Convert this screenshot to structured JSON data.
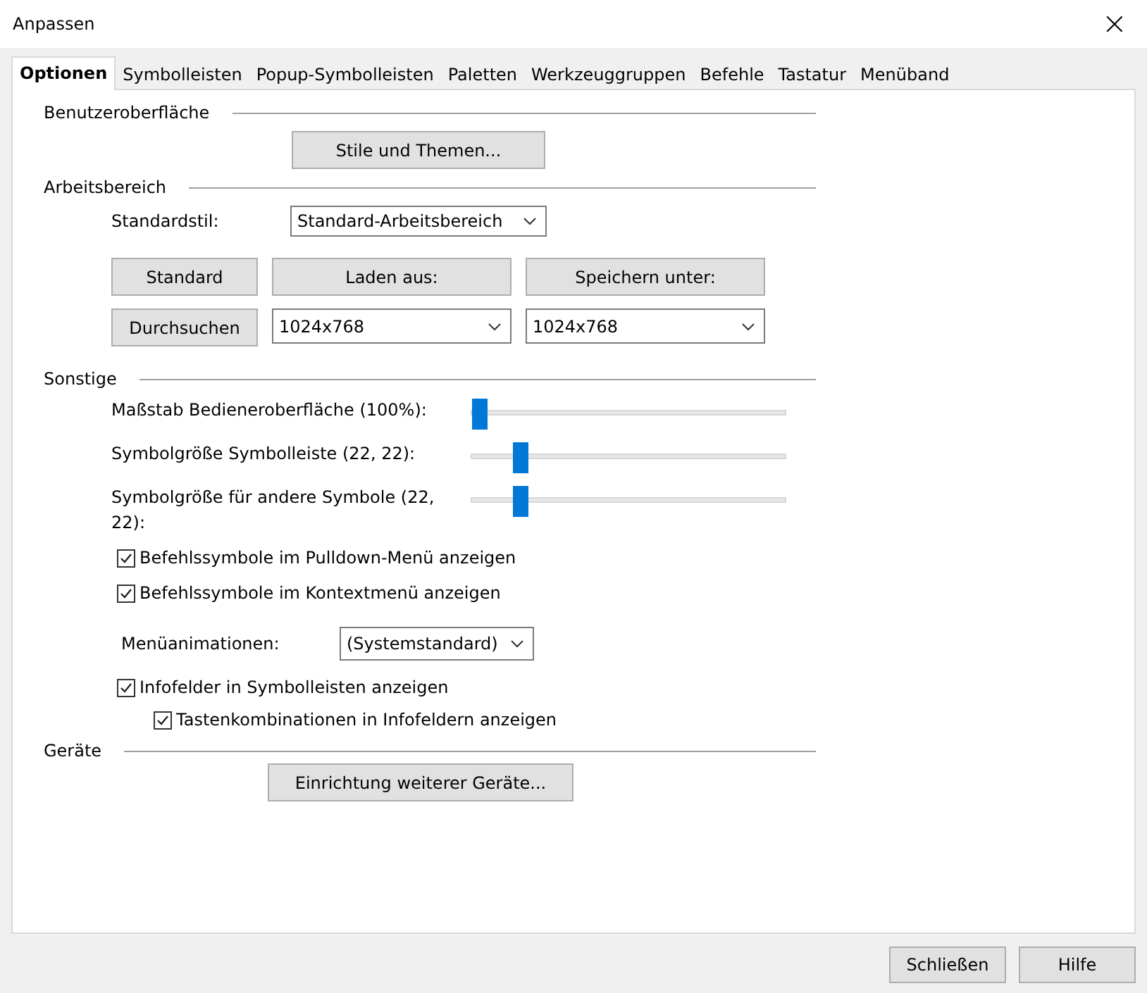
{
  "window": {
    "title": "Anpassen",
    "close": "×"
  },
  "tabs": [
    {
      "label": "Optionen",
      "selected": true
    },
    {
      "label": "Symbolleisten",
      "selected": false
    },
    {
      "label": "Popup-Symbolleisten",
      "selected": false
    },
    {
      "label": "Paletten",
      "selected": false
    },
    {
      "label": "Werkzeuggruppen",
      "selected": false
    },
    {
      "label": "Befehle",
      "selected": false
    },
    {
      "label": "Tastatur",
      "selected": false
    },
    {
      "label": "Menüband",
      "selected": false
    }
  ],
  "sections": [
    {
      "title": "Benutzeroberfläche",
      "items": [
        {
          "kind": "button",
          "label": "Stile und Themen..."
        }
      ]
    },
    {
      "title": "Arbeitsbereich",
      "items": [
        {
          "kind": "select",
          "label": "Standardstil:",
          "value": "Standard-Arbeitsbereich"
        },
        {
          "kind": "grid",
          "cells": [
            {
              "kind": "button",
              "label": "Standard"
            },
            {
              "kind": "button",
              "label": "Laden aus:"
            },
            {
              "kind": "button",
              "label": "Speichern unter:"
            },
            {
              "kind": "button",
              "label": "Durchsuchen"
            },
            {
              "kind": "select",
              "value": "1024x768"
            },
            {
              "kind": "select",
              "value": "1024x768"
            }
          ]
        }
      ]
    },
    {
      "title": "Sonstige",
      "items": [
        {
          "kind": "slider",
          "label": "Maßstab Bedieneroberfläche (100%):",
          "level": 0.0
        },
        {
          "kind": "slider",
          "label": "Symbolgröße Symbolleiste (22, 22):",
          "level": 0.13
        },
        {
          "kind": "slider",
          "label": "Symbolgröße für andere Symbole (22, 22):",
          "level": 0.13
        },
        {
          "kind": "checkbox",
          "label": "Befehlssymbole im Pulldown-Menü anzeigen",
          "checked": true
        },
        {
          "kind": "checkbox",
          "label": "Befehlssymbole im Kontextmenü anzeigen",
          "checked": true
        },
        {
          "kind": "select",
          "label": "Menüanimationen:",
          "value": "(Systemstandard)"
        },
        {
          "kind": "checkbox",
          "label": "Infofelder in Symbolleisten anzeigen",
          "checked": true,
          "children": [
            {
              "kind": "checkbox",
              "label": "Tastenkombinationen in Infofeldern anzeigen",
              "checked": true
            }
          ]
        }
      ]
    },
    {
      "title": "Geräte",
      "items": [
        {
          "kind": "button",
          "label": "Einrichtung weiterer Geräte..."
        }
      ]
    }
  ],
  "footer": {
    "buttons": [
      "Schließen",
      "Hilfe"
    ]
  }
}
